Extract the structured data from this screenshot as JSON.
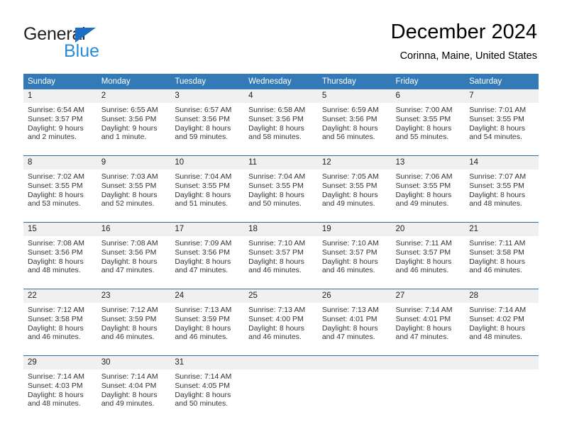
{
  "brand": {
    "name_part1": "General",
    "name_part2": "Blue",
    "triangle_color": "#1b6ec2",
    "blue_text_color": "#2a8bd4"
  },
  "header": {
    "title": "December 2024",
    "subtitle": "Corinna, Maine, United States"
  },
  "theme": {
    "header_bg": "#337ab7",
    "header_text": "#ffffff",
    "daynum_bg": "#f0f0f0",
    "row_divider": "#2d6ca2"
  },
  "weekday_headers": [
    "Sunday",
    "Monday",
    "Tuesday",
    "Wednesday",
    "Thursday",
    "Friday",
    "Saturday"
  ],
  "weeks": [
    [
      {
        "day": "1",
        "sunrise": "Sunrise: 6:54 AM",
        "sunset": "Sunset: 3:57 PM",
        "daylight1": "Daylight: 9 hours",
        "daylight2": "and 2 minutes."
      },
      {
        "day": "2",
        "sunrise": "Sunrise: 6:55 AM",
        "sunset": "Sunset: 3:56 PM",
        "daylight1": "Daylight: 9 hours",
        "daylight2": "and 1 minute."
      },
      {
        "day": "3",
        "sunrise": "Sunrise: 6:57 AM",
        "sunset": "Sunset: 3:56 PM",
        "daylight1": "Daylight: 8 hours",
        "daylight2": "and 59 minutes."
      },
      {
        "day": "4",
        "sunrise": "Sunrise: 6:58 AM",
        "sunset": "Sunset: 3:56 PM",
        "daylight1": "Daylight: 8 hours",
        "daylight2": "and 58 minutes."
      },
      {
        "day": "5",
        "sunrise": "Sunrise: 6:59 AM",
        "sunset": "Sunset: 3:56 PM",
        "daylight1": "Daylight: 8 hours",
        "daylight2": "and 56 minutes."
      },
      {
        "day": "6",
        "sunrise": "Sunrise: 7:00 AM",
        "sunset": "Sunset: 3:55 PM",
        "daylight1": "Daylight: 8 hours",
        "daylight2": "and 55 minutes."
      },
      {
        "day": "7",
        "sunrise": "Sunrise: 7:01 AM",
        "sunset": "Sunset: 3:55 PM",
        "daylight1": "Daylight: 8 hours",
        "daylight2": "and 54 minutes."
      }
    ],
    [
      {
        "day": "8",
        "sunrise": "Sunrise: 7:02 AM",
        "sunset": "Sunset: 3:55 PM",
        "daylight1": "Daylight: 8 hours",
        "daylight2": "and 53 minutes."
      },
      {
        "day": "9",
        "sunrise": "Sunrise: 7:03 AM",
        "sunset": "Sunset: 3:55 PM",
        "daylight1": "Daylight: 8 hours",
        "daylight2": "and 52 minutes."
      },
      {
        "day": "10",
        "sunrise": "Sunrise: 7:04 AM",
        "sunset": "Sunset: 3:55 PM",
        "daylight1": "Daylight: 8 hours",
        "daylight2": "and 51 minutes."
      },
      {
        "day": "11",
        "sunrise": "Sunrise: 7:04 AM",
        "sunset": "Sunset: 3:55 PM",
        "daylight1": "Daylight: 8 hours",
        "daylight2": "and 50 minutes."
      },
      {
        "day": "12",
        "sunrise": "Sunrise: 7:05 AM",
        "sunset": "Sunset: 3:55 PM",
        "daylight1": "Daylight: 8 hours",
        "daylight2": "and 49 minutes."
      },
      {
        "day": "13",
        "sunrise": "Sunrise: 7:06 AM",
        "sunset": "Sunset: 3:55 PM",
        "daylight1": "Daylight: 8 hours",
        "daylight2": "and 49 minutes."
      },
      {
        "day": "14",
        "sunrise": "Sunrise: 7:07 AM",
        "sunset": "Sunset: 3:55 PM",
        "daylight1": "Daylight: 8 hours",
        "daylight2": "and 48 minutes."
      }
    ],
    [
      {
        "day": "15",
        "sunrise": "Sunrise: 7:08 AM",
        "sunset": "Sunset: 3:56 PM",
        "daylight1": "Daylight: 8 hours",
        "daylight2": "and 48 minutes."
      },
      {
        "day": "16",
        "sunrise": "Sunrise: 7:08 AM",
        "sunset": "Sunset: 3:56 PM",
        "daylight1": "Daylight: 8 hours",
        "daylight2": "and 47 minutes."
      },
      {
        "day": "17",
        "sunrise": "Sunrise: 7:09 AM",
        "sunset": "Sunset: 3:56 PM",
        "daylight1": "Daylight: 8 hours",
        "daylight2": "and 47 minutes."
      },
      {
        "day": "18",
        "sunrise": "Sunrise: 7:10 AM",
        "sunset": "Sunset: 3:57 PM",
        "daylight1": "Daylight: 8 hours",
        "daylight2": "and 46 minutes."
      },
      {
        "day": "19",
        "sunrise": "Sunrise: 7:10 AM",
        "sunset": "Sunset: 3:57 PM",
        "daylight1": "Daylight: 8 hours",
        "daylight2": "and 46 minutes."
      },
      {
        "day": "20",
        "sunrise": "Sunrise: 7:11 AM",
        "sunset": "Sunset: 3:57 PM",
        "daylight1": "Daylight: 8 hours",
        "daylight2": "and 46 minutes."
      },
      {
        "day": "21",
        "sunrise": "Sunrise: 7:11 AM",
        "sunset": "Sunset: 3:58 PM",
        "daylight1": "Daylight: 8 hours",
        "daylight2": "and 46 minutes."
      }
    ],
    [
      {
        "day": "22",
        "sunrise": "Sunrise: 7:12 AM",
        "sunset": "Sunset: 3:58 PM",
        "daylight1": "Daylight: 8 hours",
        "daylight2": "and 46 minutes."
      },
      {
        "day": "23",
        "sunrise": "Sunrise: 7:12 AM",
        "sunset": "Sunset: 3:59 PM",
        "daylight1": "Daylight: 8 hours",
        "daylight2": "and 46 minutes."
      },
      {
        "day": "24",
        "sunrise": "Sunrise: 7:13 AM",
        "sunset": "Sunset: 3:59 PM",
        "daylight1": "Daylight: 8 hours",
        "daylight2": "and 46 minutes."
      },
      {
        "day": "25",
        "sunrise": "Sunrise: 7:13 AM",
        "sunset": "Sunset: 4:00 PM",
        "daylight1": "Daylight: 8 hours",
        "daylight2": "and 46 minutes."
      },
      {
        "day": "26",
        "sunrise": "Sunrise: 7:13 AM",
        "sunset": "Sunset: 4:01 PM",
        "daylight1": "Daylight: 8 hours",
        "daylight2": "and 47 minutes."
      },
      {
        "day": "27",
        "sunrise": "Sunrise: 7:14 AM",
        "sunset": "Sunset: 4:01 PM",
        "daylight1": "Daylight: 8 hours",
        "daylight2": "and 47 minutes."
      },
      {
        "day": "28",
        "sunrise": "Sunrise: 7:14 AM",
        "sunset": "Sunset: 4:02 PM",
        "daylight1": "Daylight: 8 hours",
        "daylight2": "and 48 minutes."
      }
    ],
    [
      {
        "day": "29",
        "sunrise": "Sunrise: 7:14 AM",
        "sunset": "Sunset: 4:03 PM",
        "daylight1": "Daylight: 8 hours",
        "daylight2": "and 48 minutes."
      },
      {
        "day": "30",
        "sunrise": "Sunrise: 7:14 AM",
        "sunset": "Sunset: 4:04 PM",
        "daylight1": "Daylight: 8 hours",
        "daylight2": "and 49 minutes."
      },
      {
        "day": "31",
        "sunrise": "Sunrise: 7:14 AM",
        "sunset": "Sunset: 4:05 PM",
        "daylight1": "Daylight: 8 hours",
        "daylight2": "and 50 minutes."
      },
      {
        "day": "",
        "sunrise": "",
        "sunset": "",
        "daylight1": "",
        "daylight2": ""
      },
      {
        "day": "",
        "sunrise": "",
        "sunset": "",
        "daylight1": "",
        "daylight2": ""
      },
      {
        "day": "",
        "sunrise": "",
        "sunset": "",
        "daylight1": "",
        "daylight2": ""
      },
      {
        "day": "",
        "sunrise": "",
        "sunset": "",
        "daylight1": "",
        "daylight2": ""
      }
    ]
  ]
}
